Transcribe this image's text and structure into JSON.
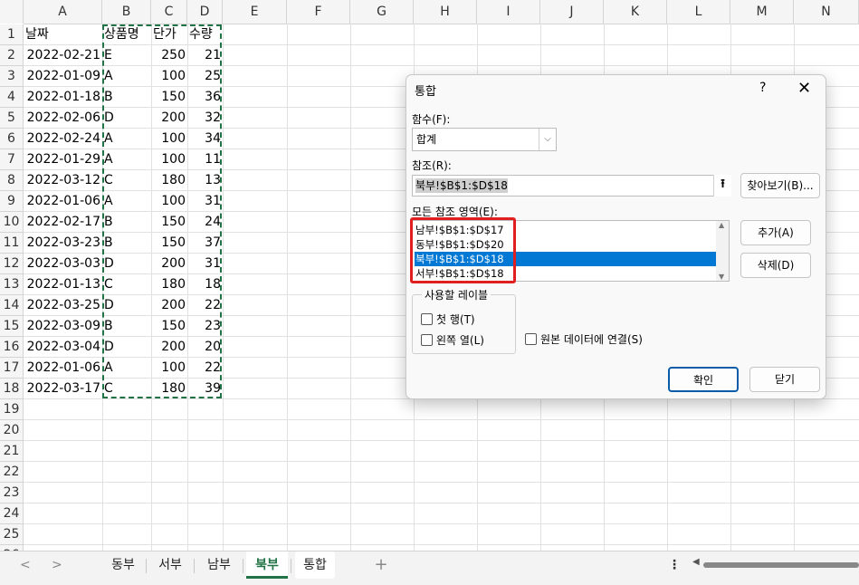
{
  "columns": [
    "A",
    "B",
    "C",
    "D",
    "E",
    "F",
    "G",
    "H",
    "I",
    "J",
    "K",
    "L",
    "M",
    "N"
  ],
  "rows": [
    "1",
    "2",
    "3",
    "4",
    "5",
    "6",
    "7",
    "8",
    "9",
    "10",
    "11",
    "12",
    "13",
    "14",
    "15",
    "16",
    "17",
    "18",
    "19",
    "20",
    "21",
    "22",
    "23",
    "24",
    "25",
    "26"
  ],
  "headers": {
    "date": "날짜",
    "product": "상품명",
    "price": "단가",
    "qty": "수량"
  },
  "table": [
    [
      "2022-02-21",
      "E",
      "250",
      "21"
    ],
    [
      "2022-01-09",
      "A",
      "100",
      "25"
    ],
    [
      "2022-01-18",
      "B",
      "150",
      "36"
    ],
    [
      "2022-02-06",
      "D",
      "200",
      "32"
    ],
    [
      "2022-02-24",
      "A",
      "100",
      "34"
    ],
    [
      "2022-01-29",
      "A",
      "100",
      "11"
    ],
    [
      "2022-03-12",
      "C",
      "180",
      "13"
    ],
    [
      "2022-01-06",
      "A",
      "100",
      "31"
    ],
    [
      "2022-02-17",
      "B",
      "150",
      "24"
    ],
    [
      "2022-03-23",
      "B",
      "150",
      "37"
    ],
    [
      "2022-03-03",
      "D",
      "200",
      "31"
    ],
    [
      "2022-01-13",
      "C",
      "180",
      "18"
    ],
    [
      "2022-03-25",
      "D",
      "200",
      "22"
    ],
    [
      "2022-03-09",
      "B",
      "150",
      "23"
    ],
    [
      "2022-03-04",
      "D",
      "200",
      "20"
    ],
    [
      "2022-01-06",
      "A",
      "100",
      "22"
    ],
    [
      "2022-03-17",
      "C",
      "180",
      "39"
    ]
  ],
  "tabs": {
    "east": "동부",
    "west": "서부",
    "south": "남부",
    "north": "북부",
    "consolidate": "통합",
    "add": "+"
  },
  "dialog": {
    "title": "통합",
    "help": "?",
    "close": "✕",
    "function_label": "함수(F):",
    "function_value": "합계",
    "reference_label": "참조(R):",
    "reference_value": "북부!$B$1:$D$18",
    "browse_button": "찾아보기(B)...",
    "all_refs_label": "모든 참조 영역(E):",
    "all_refs": [
      "남부!$B$1:$D$17",
      "동부!$B$1:$D$20",
      "북부!$B$1:$D$18",
      "서부!$B$1:$D$18"
    ],
    "selected_ref_index": 2,
    "add_button": "추가(A)",
    "delete_button": "삭제(D)",
    "use_labels_group": "사용할 레이블",
    "top_row": "첫 행(T)",
    "left_column": "왼쪽 열(L)",
    "link_source": "원본 데이터에 연결(S)",
    "ok_button": "확인",
    "close_button": "닫기"
  }
}
